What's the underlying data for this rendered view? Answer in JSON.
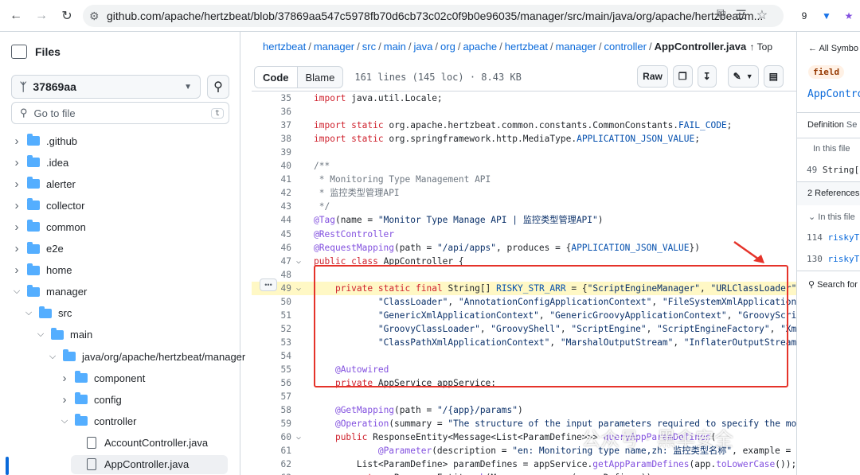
{
  "browser": {
    "url": "github.com/apache/hertzbeat/blob/37869aa547c5978fb70d6cb73c02c0f9b0e96035/manager/src/main/java/org/apache/hertzbeat/m...",
    "ext_badge": "9"
  },
  "sidebar": {
    "title": "Files",
    "branch": "37869aa",
    "goto_placeholder": "Go to file",
    "goto_kbd": "t",
    "tree": [
      {
        "label": ".github",
        "type": "folder",
        "depth": 0,
        "open": false
      },
      {
        "label": ".idea",
        "type": "folder",
        "depth": 0,
        "open": false
      },
      {
        "label": "alerter",
        "type": "folder",
        "depth": 0,
        "open": false
      },
      {
        "label": "collector",
        "type": "folder",
        "depth": 0,
        "open": false
      },
      {
        "label": "common",
        "type": "folder",
        "depth": 0,
        "open": false
      },
      {
        "label": "e2e",
        "type": "folder",
        "depth": 0,
        "open": false
      },
      {
        "label": "home",
        "type": "folder",
        "depth": 0,
        "open": false
      },
      {
        "label": "manager",
        "type": "folder",
        "depth": 0,
        "open": true
      },
      {
        "label": "src",
        "type": "folder",
        "depth": 1,
        "open": true
      },
      {
        "label": "main",
        "type": "folder",
        "depth": 2,
        "open": true
      },
      {
        "label": "java/org/apache/hertzbeat/manager",
        "type": "folder",
        "depth": 3,
        "open": true
      },
      {
        "label": "component",
        "type": "folder",
        "depth": 4,
        "open": false
      },
      {
        "label": "config",
        "type": "folder",
        "depth": 4,
        "open": false
      },
      {
        "label": "controller",
        "type": "folder",
        "depth": 4,
        "open": true
      },
      {
        "label": "AccountController.java",
        "type": "file",
        "depth": 5
      },
      {
        "label": "AppController.java",
        "type": "file",
        "depth": 5,
        "selected": true
      }
    ]
  },
  "breadcrumb": {
    "parts": [
      "hertzbeat",
      "manager",
      "src",
      "main",
      "java",
      "org",
      "apache",
      "hertzbeat",
      "manager",
      "controller"
    ],
    "current": "AppController.java",
    "top": "Top"
  },
  "toolbar": {
    "code": "Code",
    "blame": "Blame",
    "meta": "161 lines (145 loc) · 8.43 KB",
    "raw": "Raw"
  },
  "code": [
    {
      "n": "35",
      "t": "import java.util.Locale;"
    },
    {
      "n": "36",
      "t": ""
    },
    {
      "n": "37",
      "t": "import static org.apache.hertzbeat.common.constants.CommonConstants.FAIL_CODE;"
    },
    {
      "n": "38",
      "t": "import static org.springframework.http.MediaType.APPLICATION_JSON_VALUE;"
    },
    {
      "n": "39",
      "t": ""
    },
    {
      "n": "40",
      "t": "/**"
    },
    {
      "n": "41",
      "t": " * Monitoring Type Management API"
    },
    {
      "n": "42",
      "t": " * 监控类型管理API"
    },
    {
      "n": "43",
      "t": " */"
    },
    {
      "n": "44",
      "t": "@Tag(name = \"Monitor Type Manage API | 监控类型管理API\")"
    },
    {
      "n": "45",
      "t": "@RestController"
    },
    {
      "n": "46",
      "t": "@RequestMapping(path = \"/api/apps\", produces = {APPLICATION_JSON_VALUE})"
    },
    {
      "n": "47",
      "t": "public class AppController {"
    },
    {
      "n": "48",
      "t": ""
    },
    {
      "n": "49",
      "t": "    private static final String[] RISKY_STR_ARR = {\"ScriptEngineManager\", \"URLClassLoader\", \"!!\""
    },
    {
      "n": "50",
      "t": "            \"ClassLoader\", \"AnnotationConfigApplicationContext\", \"FileSystemXmlApplicationContext\""
    },
    {
      "n": "51",
      "t": "            \"GenericXmlApplicationContext\", \"GenericGroovyApplicationContext\", \"GroovyScriptEngine\""
    },
    {
      "n": "52",
      "t": "            \"GroovyClassLoader\", \"GroovyShell\", \"ScriptEngine\", \"ScriptEngineFactory\", \"XmlWebApp"
    },
    {
      "n": "53",
      "t": "            \"ClassPathXmlApplicationContext\", \"MarshalOutputStream\", \"InflaterOutputStream\", \"Fi"
    },
    {
      "n": "54",
      "t": ""
    },
    {
      "n": "55",
      "t": "    @Autowired"
    },
    {
      "n": "56",
      "t": "    private AppService appService;"
    },
    {
      "n": "57",
      "t": ""
    },
    {
      "n": "58",
      "t": "    @GetMapping(path = \"/{app}/params\")"
    },
    {
      "n": "59",
      "t": "    @Operation(summary = \"The structure of the input parameters required to specify the monitorin"
    },
    {
      "n": "60",
      "t": "    public ResponseEntity<Message<List<ParamDefine>>> queryAppParamDefines("
    },
    {
      "n": "61",
      "t": "            @Parameter(description = \"en: Monitoring type name,zh: 监控类型名称\", example = \"api\")"
    },
    {
      "n": "62",
      "t": "        List<ParamDefine> paramDefines = appService.getAppParamDefines(app.toLowerCase());"
    },
    {
      "n": "63",
      "t": "        return ResponseEntity.ok(Message.success(paramDefines));"
    }
  ],
  "right": {
    "all_symbols": "All Symbo",
    "field_badge": "field",
    "symbol_name": "AppControl",
    "def_tab": "Definition",
    "def_tab2": "Se",
    "in_this_file": "In this file",
    "def_line": "49",
    "def_text": "String[]",
    "refs_header": "2 References",
    "refs_in_file": "In this file",
    "refs": [
      {
        "n": "114",
        "t": "riskyTo"
      },
      {
        "n": "130",
        "t": "riskyTo"
      }
    ],
    "search": "Search for"
  },
  "watermark": "公众号 · 黑伞安全"
}
